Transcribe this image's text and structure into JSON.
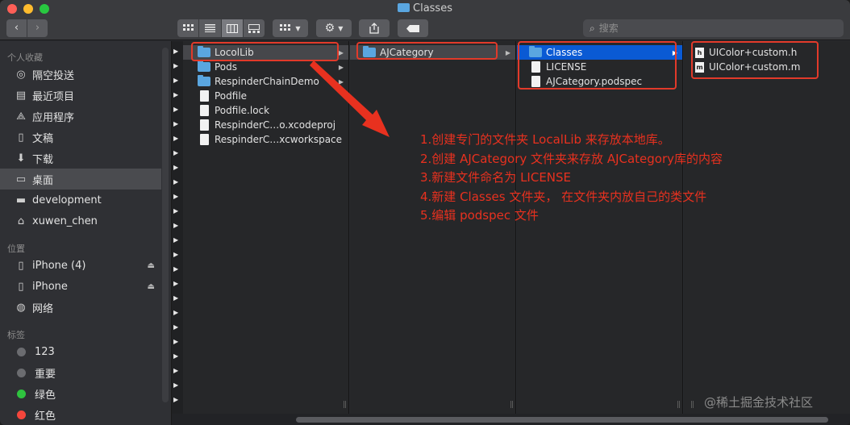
{
  "window": {
    "title": "Classes"
  },
  "toolbar": {
    "back": "‹",
    "forward": "›",
    "search_placeholder": "搜索"
  },
  "sidebar": {
    "favorites_header": "个人收藏",
    "favorites": [
      {
        "label": "隔空投送",
        "icon": "airdrop-icon"
      },
      {
        "label": "最近项目",
        "icon": "recents-icon"
      },
      {
        "label": "应用程序",
        "icon": "applications-icon"
      },
      {
        "label": "文稿",
        "icon": "documents-icon"
      },
      {
        "label": "下载",
        "icon": "downloads-icon"
      },
      {
        "label": "桌面",
        "icon": "desktop-icon",
        "selected": true
      },
      {
        "label": "development",
        "icon": "folder-icon"
      },
      {
        "label": "xuwen_chen",
        "icon": "home-icon"
      }
    ],
    "locations_header": "位置",
    "locations": [
      {
        "label": "iPhone (4)",
        "icon": "iphone-icon",
        "eject": true
      },
      {
        "label": "iPhone",
        "icon": "iphone-icon",
        "eject": true
      },
      {
        "label": "网络",
        "icon": "network-icon"
      }
    ],
    "tags_header": "标签",
    "tags": [
      {
        "label": "123",
        "color": "#6b6c70"
      },
      {
        "label": "重要",
        "color": "#6b6c70"
      },
      {
        "label": "绿色",
        "color": "#2fc33f"
      },
      {
        "label": "红色",
        "color": "#f5463c"
      }
    ]
  },
  "columns": {
    "col1": [
      {
        "name": "LocolLib",
        "type": "folder",
        "state": "highlighted"
      },
      {
        "name": "Pods",
        "type": "folder"
      },
      {
        "name": "RespinderChainDemo",
        "type": "folder"
      },
      {
        "name": "Podfile",
        "type": "doc"
      },
      {
        "name": "Podfile.lock",
        "type": "doc"
      },
      {
        "name": "RespinderC…o.xcodeproj",
        "type": "doc"
      },
      {
        "name": "RespinderC…xcworkspace",
        "type": "doc"
      }
    ],
    "col2": [
      {
        "name": "AJCategory",
        "type": "folder",
        "state": "highlighted"
      }
    ],
    "col3": [
      {
        "name": "Classes",
        "type": "folder",
        "state": "selected"
      },
      {
        "name": "LICENSE",
        "type": "doc"
      },
      {
        "name": "AJCategory.podspec",
        "type": "doc"
      }
    ],
    "col4": [
      {
        "name": "UIColor+custom.h",
        "type": "h"
      },
      {
        "name": "UIColor+custom.m",
        "type": "m"
      }
    ]
  },
  "annotation": {
    "lines": [
      "1.创建专门的文件夹 LocalLib 来存放本地库。",
      "2.创建 AJCategory 文件夹来存放 AJCategory库的内容",
      "3.新建文件命名为 LICENSE",
      "4.新建 Classes 文件夹， 在文件夹内放自己的类文件",
      "5.编辑 podspec 文件"
    ]
  },
  "watermark": "@稀土掘金技术社区",
  "colors": {
    "annotation_red": "#e23a2a",
    "selection_blue": "#0a5ad4",
    "folder_blue": "#5aa6e0"
  }
}
